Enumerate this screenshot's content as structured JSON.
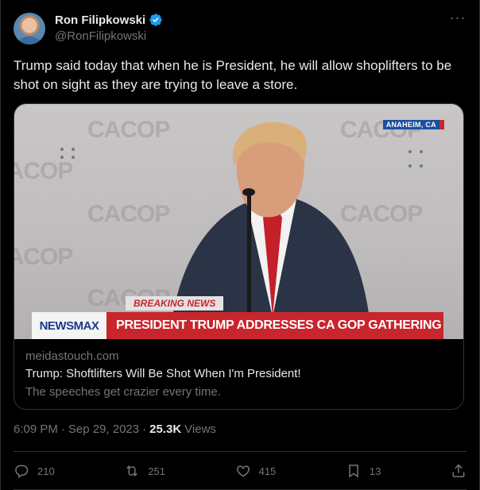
{
  "author": {
    "name": "Ron Filipkowski",
    "handle": "@RonFilipkowski",
    "verified": true
  },
  "tweet_text": "Trump said today that when he is President, he will allow shoplifters to be shot on sight as they are trying to leave a store.",
  "card": {
    "media": {
      "location_tag": "ANAHEIM, CA",
      "backdrop_logo": "CACOP",
      "breaking_label": "BREAKING NEWS",
      "network": "NEWSMAX",
      "headline": "PRESIDENT TRUMP ADDRESSES CA GOP GATHERING"
    },
    "domain": "meidastouch.com",
    "title": "Trump: Shoftlifters Will Be Shot When I'm President!",
    "description": "The speeches get crazier every time."
  },
  "meta": {
    "time": "6:09 PM",
    "separator": "·",
    "date": "Sep 29, 2023",
    "views_count": "25.3K",
    "views_label": "Views"
  },
  "actions": {
    "replies": "210",
    "reposts": "251",
    "likes": "415",
    "bookmarks": "13"
  },
  "icons": [
    "more-icon",
    "verified-icon",
    "reply-icon",
    "repost-icon",
    "like-icon",
    "bookmark-icon",
    "share-icon"
  ],
  "colors": {
    "background": "#000000",
    "text_primary": "#e7e9ea",
    "text_secondary": "#71767b",
    "verified_blue": "#1d9bf0",
    "border": "#2f3336",
    "newsmax_red": "#c8252c"
  }
}
